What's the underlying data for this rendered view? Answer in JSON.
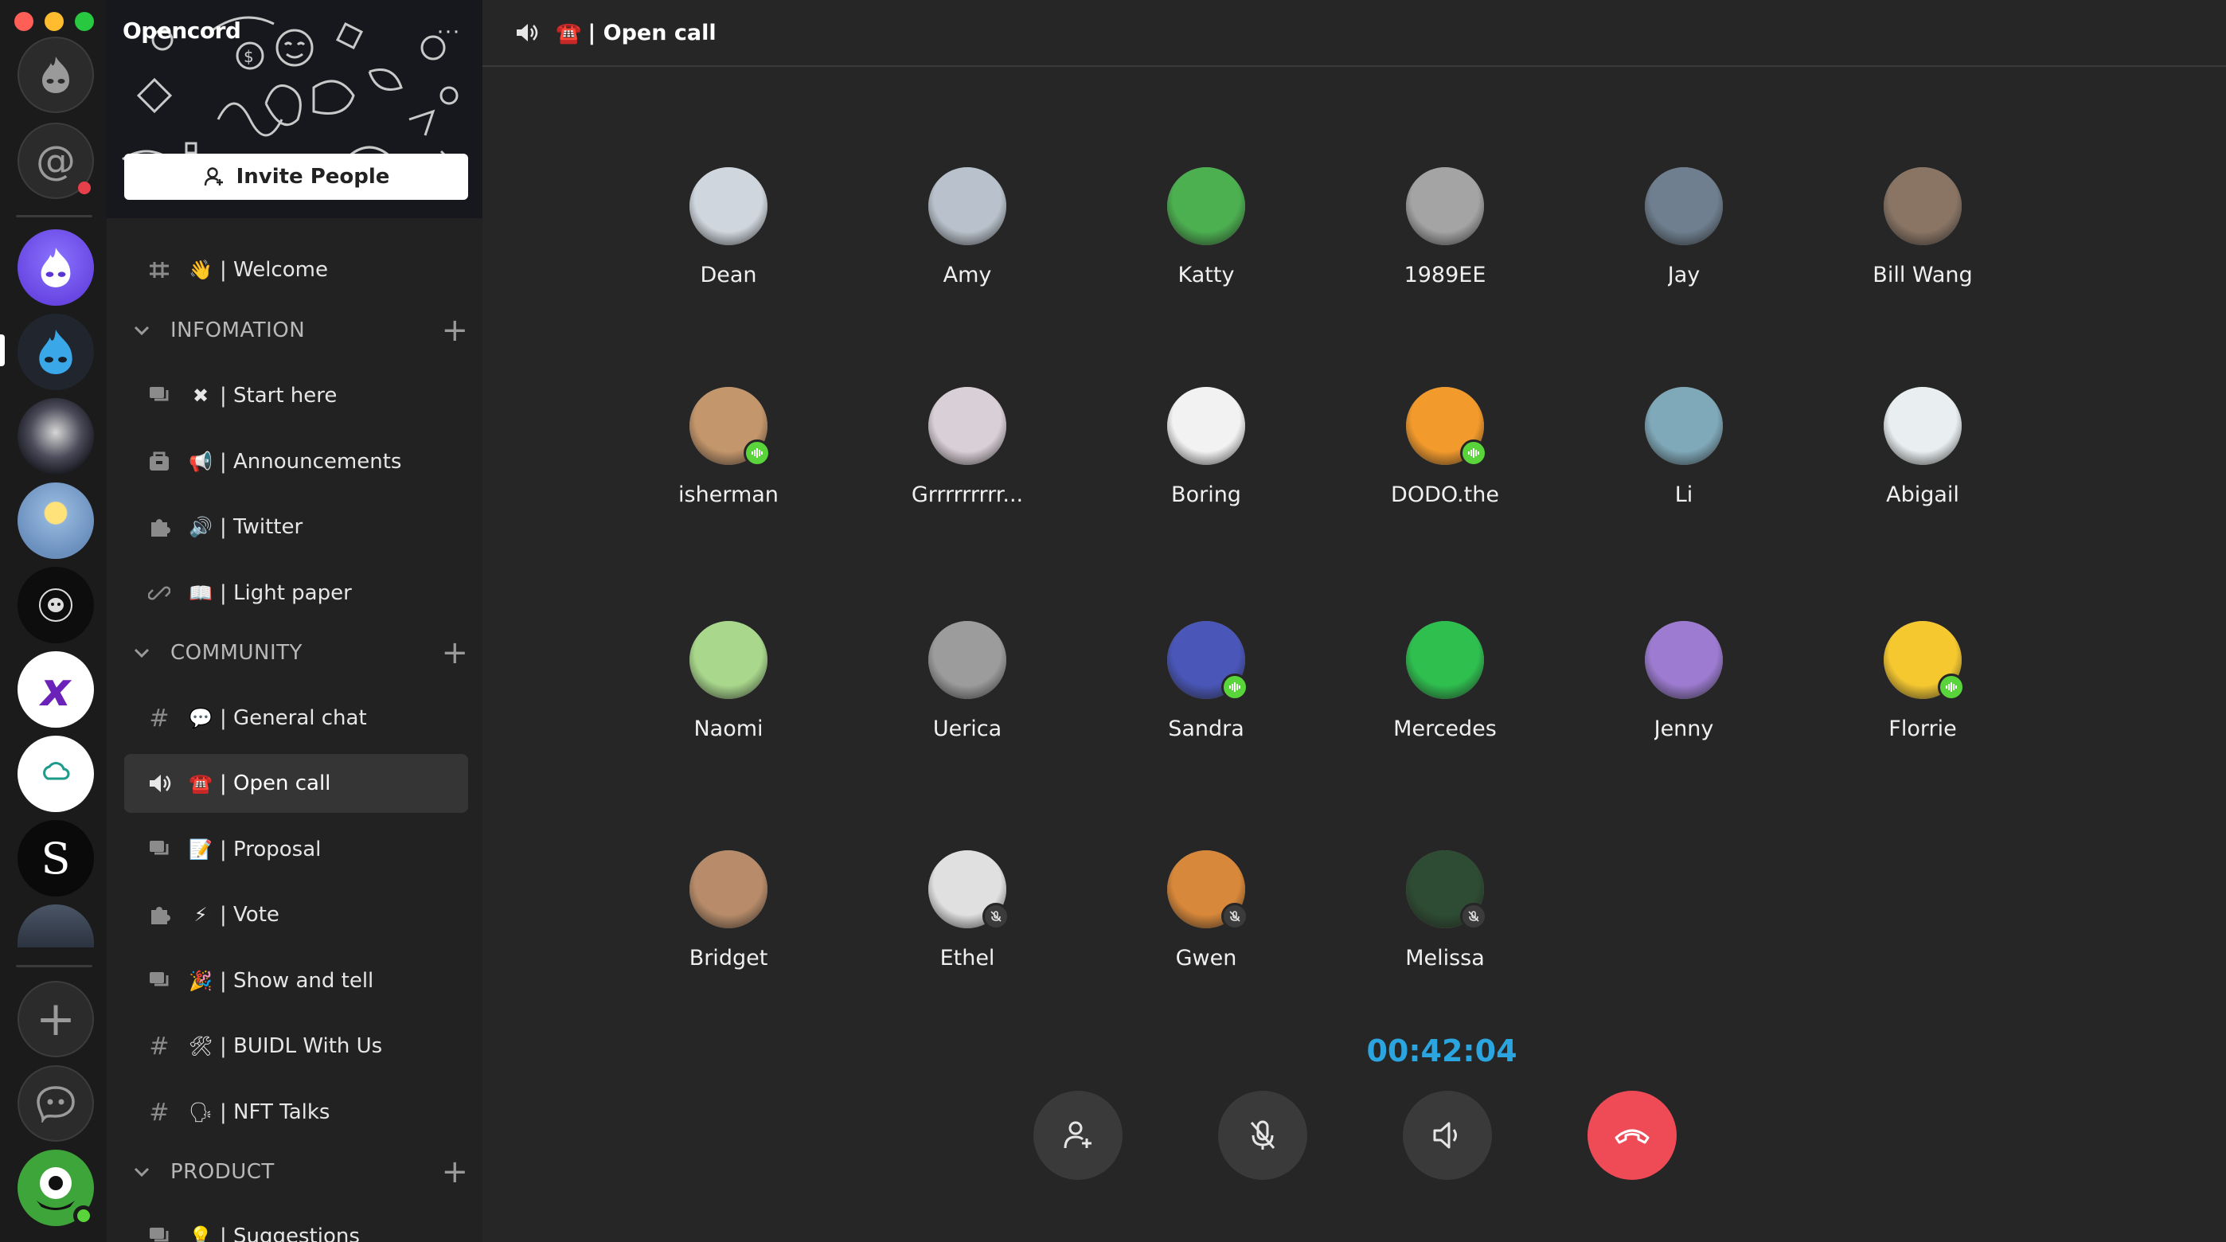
{
  "app": {
    "server_name": "Opencord",
    "server_menu_glyph": "···"
  },
  "sidebar": {
    "invite_label": "Invite People",
    "categories": {
      "information": "INFOMATION",
      "community": "COMMUNITY",
      "product": "PRODUCT"
    },
    "channels": [
      {
        "icon": "rules-icon",
        "emoji": "👋",
        "label": "| Welcome"
      },
      {
        "icon": "forum-icon",
        "emoji": "✖",
        "label": "| Start here"
      },
      {
        "icon": "announcement-icon",
        "emoji": "📢",
        "label": "| Announcements"
      },
      {
        "icon": "plugin-icon",
        "emoji": "🔊",
        "label": "| Twitter"
      },
      {
        "icon": "link-icon",
        "emoji": "📖",
        "label": "| Light paper"
      },
      {
        "icon": "hash-icon",
        "emoji": "💬",
        "label": "| General chat"
      },
      {
        "icon": "speaker-icon",
        "emoji": "☎️",
        "label": "| Open call"
      },
      {
        "icon": "forum-icon",
        "emoji": "📝",
        "label": "| Proposal"
      },
      {
        "icon": "plugin-icon",
        "emoji": "⚡",
        "label": "| Vote"
      },
      {
        "icon": "forum-icon",
        "emoji": "🎉",
        "label": "| Show and tell"
      },
      {
        "icon": "hash-icon",
        "emoji": "🛠",
        "label": "| BUIDL With Us"
      },
      {
        "icon": "hash-icon",
        "emoji": "🗣",
        "label": "| NFT Talks"
      },
      {
        "icon": "forum-icon",
        "emoji": "💡",
        "label": "| Suggestions"
      }
    ],
    "active_channel": "| Open call"
  },
  "header": {
    "emoji": "☎️",
    "title": "| Open call"
  },
  "call": {
    "participants": [
      {
        "name": "Dean",
        "status": "none",
        "color": "#cfd6dd"
      },
      {
        "name": "Amy",
        "status": "none",
        "color": "#b9c2cc"
      },
      {
        "name": "Katty",
        "status": "none",
        "color": "#4caf50"
      },
      {
        "name": "1989EE",
        "status": "none",
        "color": "#a4a4a4"
      },
      {
        "name": "Jay",
        "status": "none",
        "color": "#6f7f8f"
      },
      {
        "name": "Bill Wang",
        "status": "none",
        "color": "#8a7565"
      },
      {
        "name": "isherman",
        "status": "speaking",
        "color": "#c4966b"
      },
      {
        "name": "Grrrrrrrrr...",
        "status": "none",
        "color": "#d9cfd6"
      },
      {
        "name": "Boring",
        "status": "none",
        "color": "#f2f2f2"
      },
      {
        "name": "DODO.the",
        "status": "speaking",
        "color": "#f39a2c"
      },
      {
        "name": "Li",
        "status": "none",
        "color": "#7fa8b8"
      },
      {
        "name": "Abigail",
        "status": "none",
        "color": "#e9eef0"
      },
      {
        "name": "Naomi",
        "status": "none",
        "color": "#a9d88c"
      },
      {
        "name": "Uerica",
        "status": "none",
        "color": "#9c9c9c"
      },
      {
        "name": "Sandra",
        "status": "speaking",
        "color": "#4a56b8"
      },
      {
        "name": "Mercedes",
        "status": "none",
        "color": "#2fbf4f"
      },
      {
        "name": "Jenny",
        "status": "none",
        "color": "#9c7bd0"
      },
      {
        "name": "Florrie",
        "status": "speaking",
        "color": "#f5c830"
      },
      {
        "name": "Bridget",
        "status": "none",
        "color": "#b88c6a"
      },
      {
        "name": "Ethel",
        "status": "muted",
        "color": "#e0e0e0"
      },
      {
        "name": "Gwen",
        "status": "muted",
        "color": "#d8883a"
      },
      {
        "name": "Melissa",
        "status": "muted",
        "color": "#2e4c33"
      }
    ],
    "timer": "00:42:04",
    "controls": {
      "add_person_icon": "add-person-icon",
      "mic_off_icon": "mic-off-icon",
      "speaker_icon": "speaker-icon",
      "hang_up_icon": "hang-up-icon",
      "hang_up_color": "#ef4b57"
    }
  },
  "colors": {
    "accent_timer": "#2ba5e0",
    "speaking": "#5ad43b",
    "notification": "#e8404a"
  }
}
